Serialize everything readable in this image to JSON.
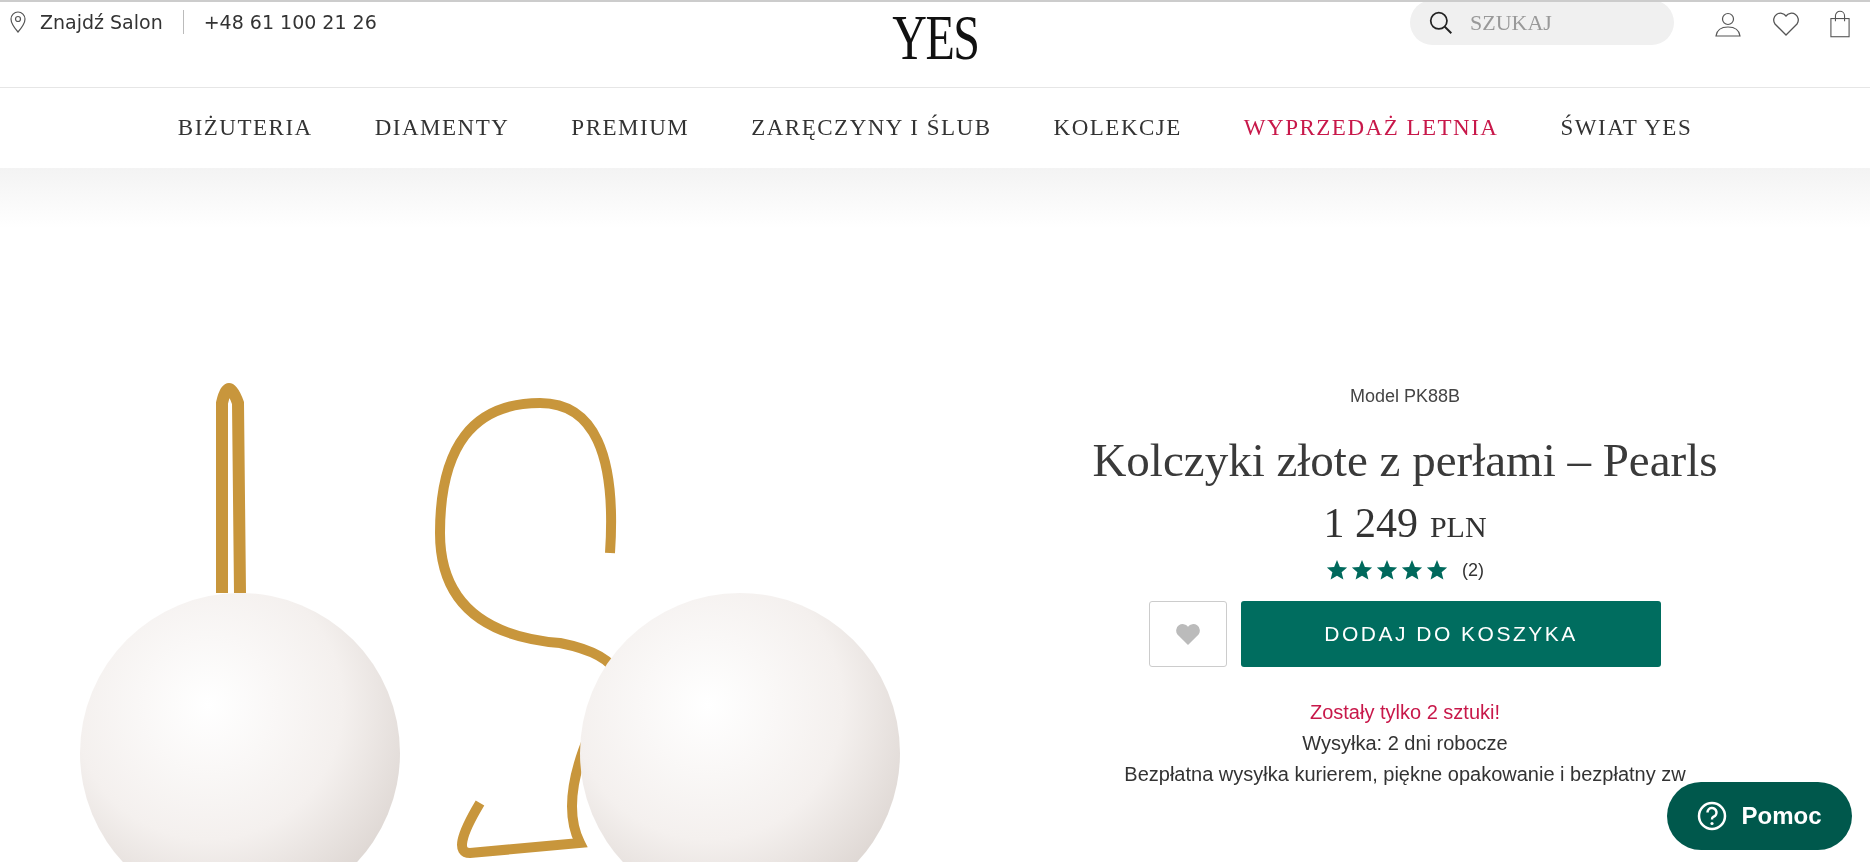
{
  "topbar": {
    "store_link": "Znajdź Salon",
    "phone": "+48 61 100 21 26",
    "logo": "YES",
    "search": {
      "placeholder": "SZUKAJ"
    }
  },
  "nav": [
    {
      "label": "BIŻUTERIA",
      "highlight": false
    },
    {
      "label": "DIAMENTY",
      "highlight": false
    },
    {
      "label": "PREMIUM",
      "highlight": false
    },
    {
      "label": "ZARĘCZYNY I ŚLUB",
      "highlight": false
    },
    {
      "label": "KOLEKCJE",
      "highlight": false
    },
    {
      "label": "WYPRZEDAŻ LETNIA",
      "highlight": true
    },
    {
      "label": "ŚWIAT YES",
      "highlight": false
    }
  ],
  "product": {
    "model": "Model PK88B",
    "title": "Kolczyki złote z perłami – Pearls",
    "price": "1 249",
    "currency": "PLN",
    "stars": 5,
    "reviews": "(2)",
    "add_to_cart": "DODAJ DO KOSZYKA",
    "stock": "Zostały tylko 2 sztuki!",
    "shipping": "Wysyłka: 2 dni robocze",
    "free_shipping": "Bezpłatna wysyłka kurierem, piękne opakowanie i bezpłatny zw"
  },
  "help_button": "Pomoc"
}
